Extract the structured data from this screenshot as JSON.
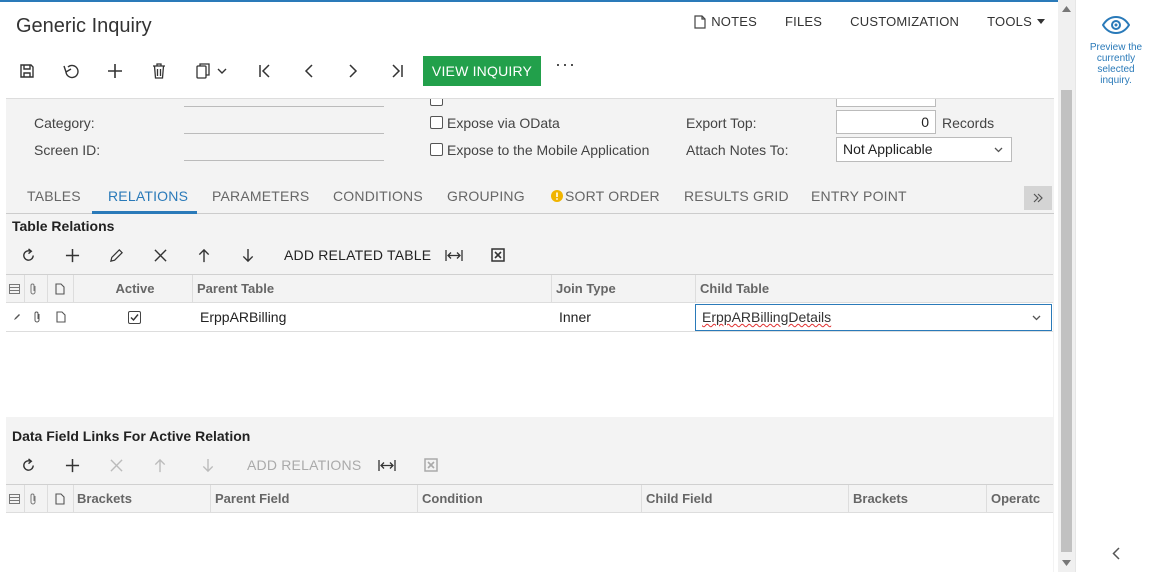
{
  "title": "Generic Inquiry",
  "top_links": {
    "notes": "NOTES",
    "files": "FILES",
    "customization": "CUSTOMIZATION",
    "tools": "TOOLS"
  },
  "toolbar": {
    "view_inquiry": "VIEW INQUIRY",
    "more": "···",
    "icons": [
      "save-icon",
      "undo-icon",
      "add-icon",
      "delete-icon",
      "copy-paste-icon",
      "first-icon",
      "previous-icon",
      "next-icon",
      "last-icon"
    ]
  },
  "form": {
    "category_label": "Category:",
    "screen_id_label": "Screen ID:",
    "expose_odata_label": "Expose via OData",
    "expose_odata_checked": false,
    "expose_mobile_label": "Expose to the Mobile Application",
    "expose_mobile_checked": false,
    "export_top_label": "Export Top:",
    "export_top_value": "0",
    "records_label": "Records",
    "attach_notes_label": "Attach Notes To:",
    "attach_notes_value": "Not Applicable"
  },
  "tabs": {
    "tables": "TABLES",
    "relations": "RELATIONS",
    "parameters": "PARAMETERS",
    "conditions": "CONDITIONS",
    "grouping": "GROUPING",
    "sort_order": "SORT ORDER",
    "results_grid": "RESULTS GRID",
    "entry_point": "ENTRY POINT",
    "active": "RELATIONS"
  },
  "table_relations": {
    "title": "Table Relations",
    "add_related_table": "ADD RELATED TABLE",
    "columns": {
      "active": "Active",
      "parent_table": "Parent Table",
      "join_type": "Join Type",
      "child_table": "Child Table"
    },
    "rows": [
      {
        "active": true,
        "parent_table": "ErppARBilling",
        "join_type": "Inner",
        "child_table": "ErppARBillingDetails"
      }
    ]
  },
  "data_field_links": {
    "title": "Data Field Links For Active Relation",
    "add_relations": "ADD RELATIONS",
    "columns": {
      "brackets_open": "Brackets",
      "parent_field": "Parent Field",
      "condition": "Condition",
      "child_field": "Child Field",
      "brackets_close": "Brackets",
      "operator": "Operatc"
    }
  },
  "right_panel": {
    "preview_text": "Preview the currently selected inquiry."
  },
  "colors": {
    "accent": "#2a7ab9",
    "view_button": "#22a04b",
    "warning": "#f0b400"
  }
}
